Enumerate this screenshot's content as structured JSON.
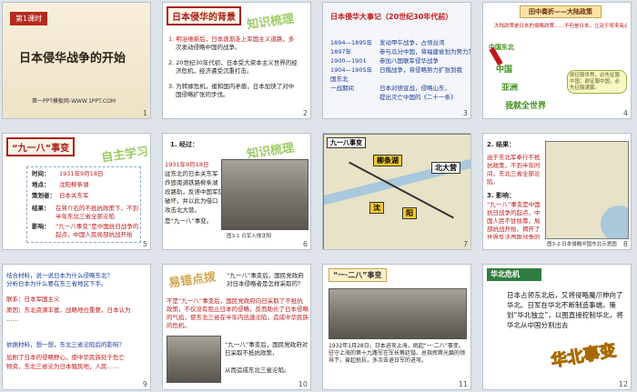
{
  "slides": [
    {
      "num": "1",
      "lesson": "第1课时",
      "title": "日本侵华战争的开始",
      "footer": "第一PPT模板网-WWW.1PPT.COM"
    },
    {
      "num": "2",
      "title": "日本侵华的背景",
      "stamp": "知识梳理",
      "lines": [
        "1. 明治维新后，日本逐渐走上军国主义道路，多",
        "次发动侵略中国的战争。",
        "2. 20世纪30年代初，日本受大资本主义世界的经",
        "济危机，经济遭受沉重打击。",
        "3. 为转嫁危机，缓和国内矛盾，日本加快了对中",
        "国侵略扩张的步伐。"
      ]
    },
    {
      "num": "3",
      "title": "日本侵华大事记（20世纪30年代前）",
      "years": [
        "1894—1895年",
        "1897年",
        "1900—1901",
        "1904—1905年",
        "国东北",
        "一战期间"
      ],
      "events": [
        "发动甲午战争，占领台湾",
        "参与瓜分中国，将福建省划为势力范围",
        "参加八国联军侵华战争",
        "日俄战争，将侵略势力扩张到我",
        "",
        "日本对德宣战，侵略山东，",
        "提出灭亡中国的《二十一条》"
      ]
    },
    {
      "num": "4",
      "header": "田中奏折——大陆政策",
      "intro": "大陆政策是日本的侵略政策……不但是日本，立足于将来有必要征服中国……",
      "labels": [
        "中国东北",
        "中国",
        "亚洲",
        "我就全世界"
      ],
      "bubble": "欲征服世界，必先征服中国；欲征服中国，必先征服满蒙。"
    },
    {
      "num": "5",
      "title": "“九一八”事变",
      "stamp": "自主学习",
      "fields": [
        {
          "label": "时间：",
          "value": "1931年9月18日"
        },
        {
          "label": "地点：",
          "value": "沈阳柳条湖"
        },
        {
          "label": "策划者：",
          "value": "日本关东军"
        },
        {
          "label": "结果：",
          "value": "在蒋介石的不抵抗政策下，不到半年东北三省全部沦陷"
        },
        {
          "label": "影响：",
          "value": "“九一八事变”是中国抗日战争的起点，中国人民局部抗战开始"
        }
      ]
    },
    {
      "num": "6",
      "section": "1. 经过：",
      "stamp": "知识梳理",
      "lines": [
        "1931年9月18日",
        "驻东北的日本关东军",
        "炸毁南满铁路柳条湖",
        "段路轨，反诬中国军队",
        "破坏，并以此为借口",
        "攻击北大营。",
        "是“九一八”事变。"
      ],
      "caption": "图3-1 日军入侵沈阳"
    },
    {
      "num": "7",
      "map_title": "九一八事变",
      "labels": [
        "柳条湖",
        "北大营",
        "沈",
        "阳"
      ]
    },
    {
      "num": "8",
      "section": "2. 结果：",
      "result": "由于东北军奉行不抵抗政策，不到半年时间，东北三省全部沦陷。",
      "section2": "3. 影响：",
      "impact": "“九一八”事变是中国抗日战争的起点，中国人民不甘屈辱，局部抗战开始，揭开了世界反法西斯战争的序幕。",
      "caption": "图3-2 日本侵略中国东北示意图"
    },
    {
      "num": "9",
      "lines": [
        "结合材料，说一说日本为什么侵略东北？",
        "分析日本为什么要在东三省地区下手。",
        "联系：日本军国主义",
        "原因：东北资源丰富，战略地位重要，日本认为",
        "……",
        "依据材料，想一想，东北三省沦陷后的影响？",
        "加剧了日本的侵略野心，使中华民族处于危亡",
        "物资，东北三省沦为日本殖民地，人民……"
      ]
    },
    {
      "num": "10",
      "stamp": "易错点拨",
      "lines": [
        "“九一八”事变后，国民党政府对日本侵略者是怎样采取的？",
        "不是“九一八”事变后，国民党政府向日采取了不抵抗",
        "政策，不仅没有阻止日本的侵略，反而助长了日本侵略",
        "的气焰，使东北三省在半年内迅速沦陷，造成中华民族",
        "的危机。",
        "“九一八”事变后，国民党政府对日采取不抵抗政策，",
        "从而造成东北三省沦陷。"
      ]
    },
    {
      "num": "11",
      "title": "“一·二八”事变",
      "caption": "1932年1月28日，日本进攻上海，挑起“一·二八”事变。驻守上海的第十九路军在军长蔡廷锴、总指挥蒋光鼐的领导下，奋起抵抗，多次击退日军的进攻。"
    },
    {
      "num": "12",
      "header": "华北危机",
      "text": "日本占领东北后，又将侵略魔爪伸向了华北。日军在华北不断制造事端，策划“华北独立”，以图直接控制华北，将华北从中国分割出去",
      "stamp": "华北事变"
    }
  ],
  "colors": {
    "accent": "#a92018",
    "green": "#2f7e41",
    "gold": "#f1c232"
  }
}
